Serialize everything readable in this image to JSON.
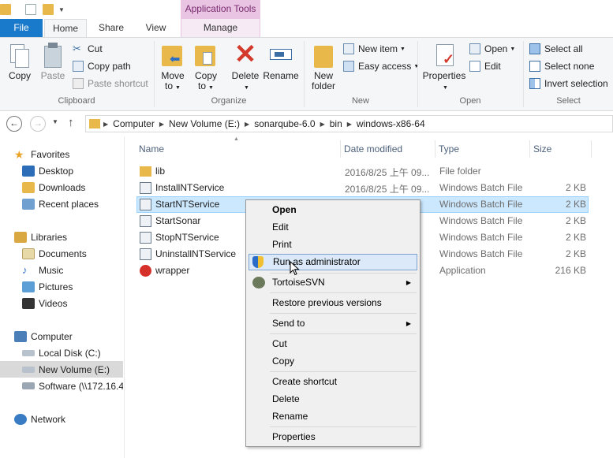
{
  "ribbon_context": {
    "header": "Application Tools",
    "tab": "Manage"
  },
  "tabs": {
    "file": "File",
    "home": "Home",
    "share": "Share",
    "view": "View"
  },
  "clipboard": {
    "copy": "Copy",
    "paste": "Paste",
    "cut": "Cut",
    "copy_path": "Copy path",
    "paste_shortcut": "Paste shortcut",
    "label": "Clipboard"
  },
  "organize": {
    "move_to_1": "Move",
    "move_to_2": "to",
    "copy_to_1": "Copy",
    "copy_to_2": "to",
    "delete": "Delete",
    "rename": "Rename",
    "label": "Organize"
  },
  "new": {
    "new_folder_1": "New",
    "new_folder_2": "folder",
    "new_item": "New item",
    "easy_access": "Easy access",
    "label": "New"
  },
  "open": {
    "properties": "Properties",
    "open": "Open",
    "edit": "Edit",
    "label": "Open"
  },
  "select": {
    "select_all": "Select all",
    "select_none": "Select none",
    "invert": "Invert selection",
    "label": "Select"
  },
  "breadcrumb": [
    "Computer",
    "New Volume (E:)",
    "sonarqube-6.0",
    "bin",
    "windows-x86-64"
  ],
  "nav": {
    "favorites": "Favorites",
    "desktop": "Desktop",
    "downloads": "Downloads",
    "recent": "Recent places",
    "libraries": "Libraries",
    "documents": "Documents",
    "music": "Music",
    "pictures": "Pictures",
    "videos": "Videos",
    "computer": "Computer",
    "local_disk": "Local Disk (C:)",
    "new_volume": "New Volume (E:)",
    "software": "Software (\\\\172.16.4",
    "network": "Network"
  },
  "columns": {
    "name": "Name",
    "date": "Date modified",
    "type": "Type",
    "size": "Size"
  },
  "files": [
    {
      "name": "lib",
      "date": "2016/8/25 上午 09...",
      "type": "File folder",
      "size": ""
    },
    {
      "name": "InstallNTService",
      "date": "2016/8/25 上午 09...",
      "type": "Windows Batch File",
      "size": "2 KB"
    },
    {
      "name": "StartNTService",
      "date": "",
      "type": "Windows Batch File",
      "size": "2 KB"
    },
    {
      "name": "StartSonar",
      "date": "",
      "type": "Windows Batch File",
      "size": "2 KB"
    },
    {
      "name": "StopNTService",
      "date": "",
      "type": "Windows Batch File",
      "size": "2 KB"
    },
    {
      "name": "UninstallNTService",
      "date": "",
      "type": "Windows Batch File",
      "size": "2 KB"
    },
    {
      "name": "wrapper",
      "date": "",
      "type": "Application",
      "size": "216 KB"
    }
  ],
  "context_menu": {
    "open": "Open",
    "edit": "Edit",
    "print": "Print",
    "run_as_admin": "Run as administrator",
    "tortoise": "TortoiseSVN",
    "restore": "Restore previous versions",
    "send_to": "Send to",
    "cut": "Cut",
    "copy": "Copy",
    "create_shortcut": "Create shortcut",
    "delete": "Delete",
    "rename": "Rename",
    "properties": "Properties"
  },
  "colors": {
    "accent": "#1979ca",
    "context_tab": "#e9c4e3",
    "selection": "#cce8ff",
    "folder": "#e8b84a"
  }
}
